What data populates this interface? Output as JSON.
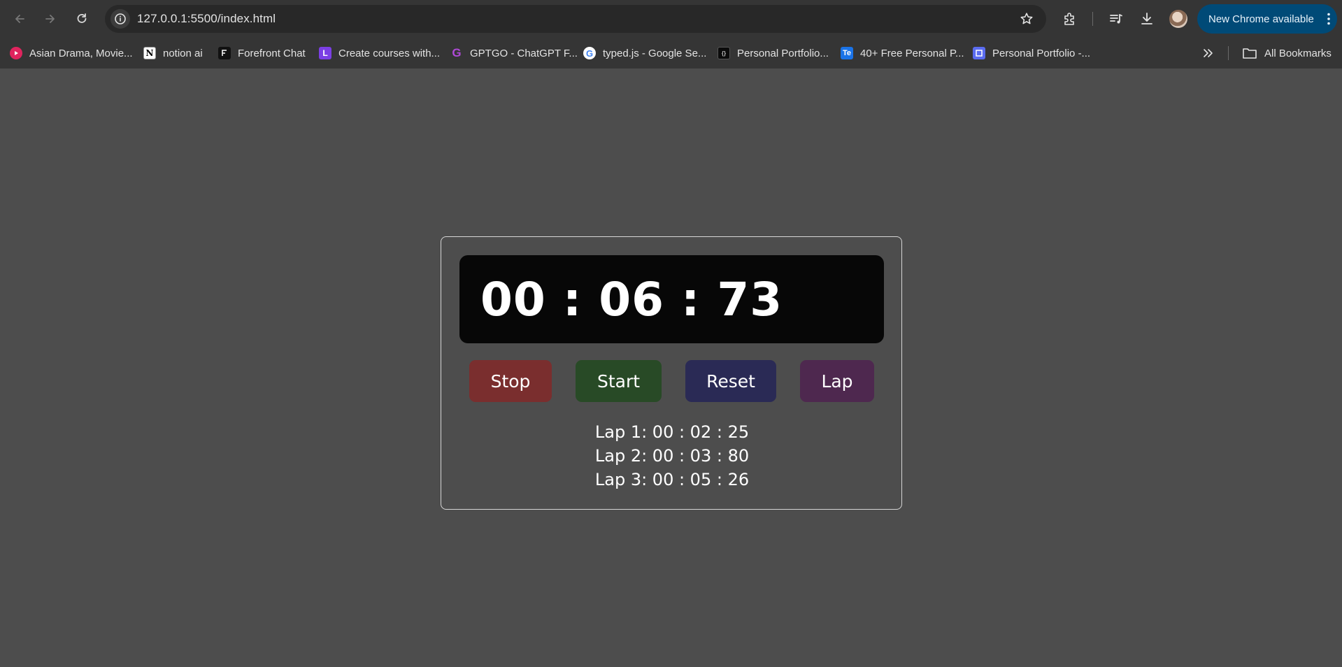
{
  "browser": {
    "url": "127.0.0.1:5500/index.html",
    "update_label": "New Chrome available",
    "all_bookmarks_label": "All Bookmarks",
    "bookmarks": [
      {
        "label": "Asian Drama, Movie...",
        "icon": "play-circle-icon",
        "color": "#e0245e"
      },
      {
        "label": "notion ai",
        "icon": "notion-icon",
        "color": "#ffffff"
      },
      {
        "label": "Forefront Chat",
        "icon": "forefront-icon",
        "color": "#111111"
      },
      {
        "label": "Create courses with...",
        "icon": "letter-l-icon",
        "color": "#7b3fe4"
      },
      {
        "label": "GPTGO - ChatGPT F...",
        "icon": "letter-g-icon",
        "color": "#b04ad8"
      },
      {
        "label": "typed.js - Google Se...",
        "icon": "google-icon",
        "color": "#4285f4"
      },
      {
        "label": "Personal Portfolio...",
        "icon": "code-icon",
        "color": "#0b0b0b"
      },
      {
        "label": "40+ Free Personal P...",
        "icon": "te-icon",
        "color": "#1a73e8"
      },
      {
        "label": "Personal Portfolio -...",
        "icon": "square-icon",
        "color": "#5a6cf0"
      }
    ]
  },
  "stopwatch": {
    "time": "00 : 06 : 73",
    "buttons": {
      "stop": {
        "label": "Stop",
        "color": "#7a2e2e"
      },
      "start": {
        "label": "Start",
        "color": "#284a26"
      },
      "reset": {
        "label": "Reset",
        "color": "#2a2a55"
      },
      "lap": {
        "label": "Lap",
        "color": "#4e284f"
      }
    },
    "laps": [
      "Lap 1: 00 : 02 : 25",
      "Lap 2: 00 : 03 : 80",
      "Lap 3: 00 : 05 : 26"
    ]
  }
}
